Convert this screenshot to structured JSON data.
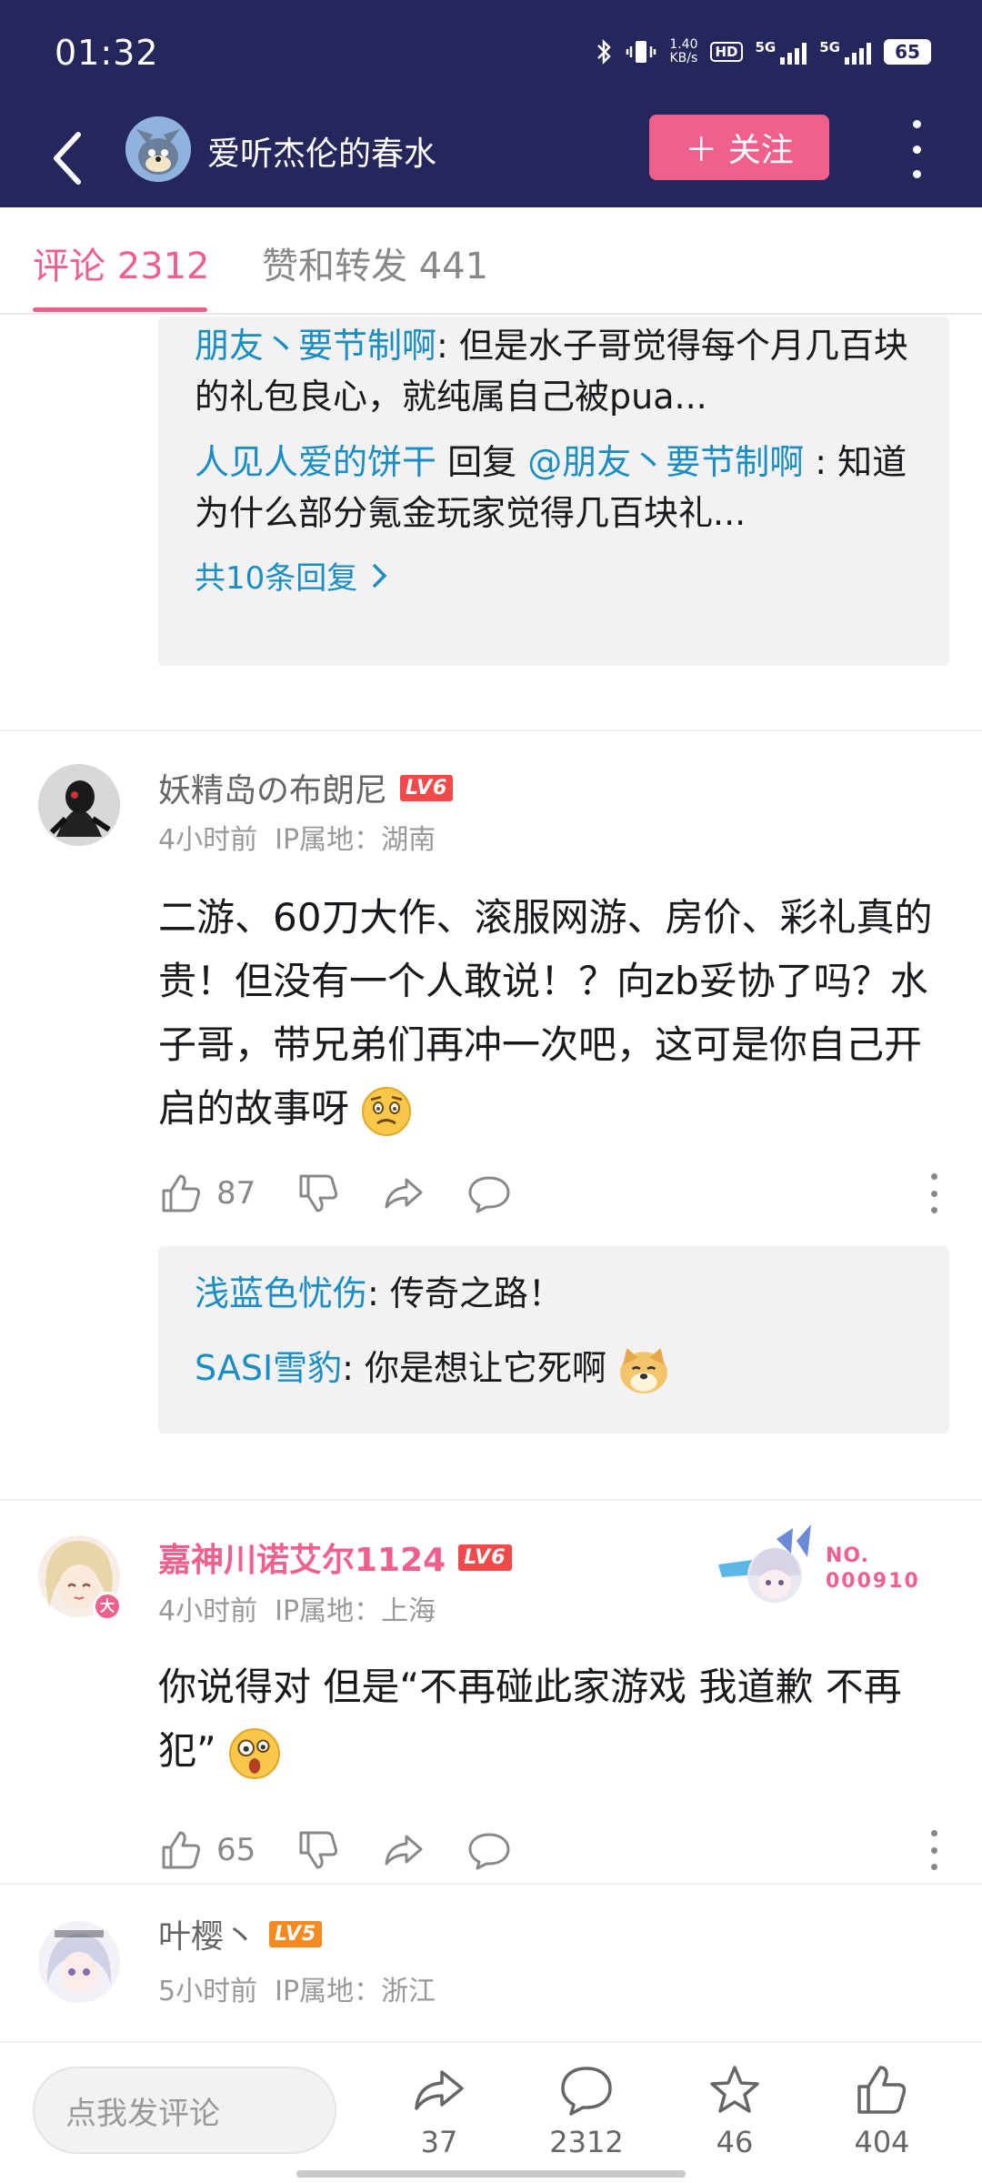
{
  "status_bar": {
    "time": "01:32",
    "net_speed_value": "1.40",
    "net_speed_unit": "KB/s",
    "hd": "HD",
    "sim1": "5G",
    "sim2": "5G",
    "battery": "65"
  },
  "header": {
    "title": "爱听杰伦的春水",
    "follow_label": "＋ 关注",
    "back_icon": "back-arrow-icon",
    "more_icon": "more-vertical-icon"
  },
  "tabs": [
    {
      "label": "评论 2312",
      "active": true
    },
    {
      "label": "赞和转发 441",
      "active": false
    }
  ],
  "top_reply_box": {
    "replies": [
      {
        "user": "朋友丶要节制啊",
        "text": ": 但是水子哥觉得每个月几百块的礼包良心，就纯属自己被pua..."
      },
      {
        "user": "人见人爱的饼干",
        "reply_word": " 回复 ",
        "reply_to": "@朋友丶要节制啊",
        "text": " : 知道为什么部分氪金玩家觉得几百块礼..."
      }
    ],
    "more_label": "共10条回复"
  },
  "comments": [
    {
      "username": "妖精岛の布朗尼",
      "level": "LV6",
      "time": "4小时前",
      "ip": "IP属地：湖南",
      "text": "二游、60刀大作、滚服网游、房价、彩礼真的贵！但没有一个人敢说！？向zb妥协了吗？水子哥，带兄弟们再冲一次吧，这可是你自己开启的故事呀",
      "likes": "87",
      "replies": [
        {
          "user": "浅蓝色忧伤",
          "text": ": 传奇之路！"
        },
        {
          "user": "SASI雪豹",
          "text": ": 你是想让它死啊"
        }
      ]
    },
    {
      "username": "嘉神川诺艾尔1124",
      "level": "LV6",
      "time": "4小时前",
      "ip": "IP属地：上海",
      "badge_text_1": "NO.",
      "badge_text_2": "000910",
      "text": "你说得对 但是“不再碰此家游戏 我道歉 不再犯”",
      "likes": "65",
      "avatar_badge": "大"
    },
    {
      "username": "叶樱丶",
      "level": "LV5",
      "time": "5小时前",
      "ip": "IP属地：浙江"
    }
  ],
  "bottom_bar": {
    "input_placeholder": "点我发评论",
    "share_count": "37",
    "comment_count": "2312",
    "favorite_count": "46",
    "like_count": "404"
  },
  "colors": {
    "header_bg": "#25275c",
    "accent_pink": "#f0608d",
    "link_blue": "#1a8dc3",
    "lv6": "#f24a4a",
    "lv5": "#f58a23"
  }
}
